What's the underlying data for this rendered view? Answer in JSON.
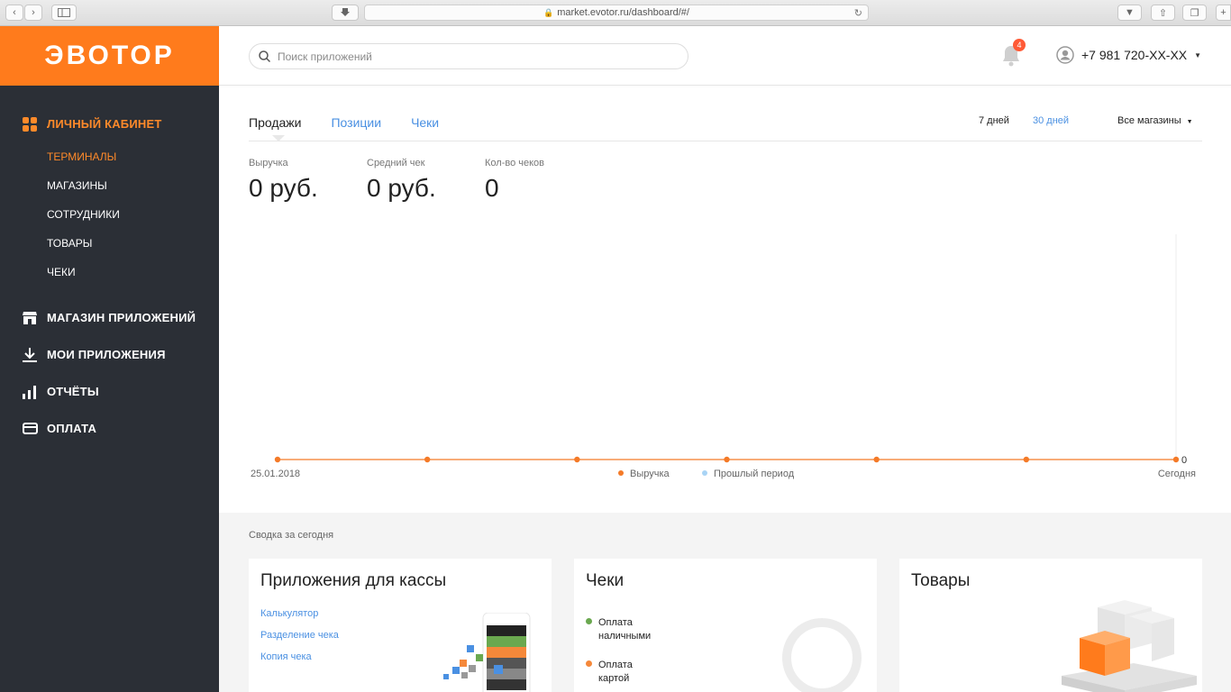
{
  "browser": {
    "url": "market.evotor.ru/dashboard/#/"
  },
  "brand": {
    "logo_text": "ЭВОТОР",
    "accent": "#ff7b1c"
  },
  "sidebar": {
    "personal": {
      "label": "ЛИЧНЫЙ КАБИНЕТ",
      "icon": "grid-icon"
    },
    "sub_items": [
      {
        "label": "ТЕРМИНАЛЫ",
        "active": true
      },
      {
        "label": "МАГАЗИНЫ"
      },
      {
        "label": "СОТРУДНИКИ"
      },
      {
        "label": "ТОВАРЫ"
      },
      {
        "label": "ЧЕКИ"
      }
    ],
    "sections": [
      {
        "label": "МАГАЗИН ПРИЛОЖЕНИЙ",
        "icon": "store-icon"
      },
      {
        "label": "МОИ ПРИЛОЖЕНИЯ",
        "icon": "download-icon"
      },
      {
        "label": "ОТЧЁТЫ",
        "icon": "bar-chart-icon"
      },
      {
        "label": "ОПЛАТА",
        "icon": "credit-card-icon"
      }
    ]
  },
  "topbar": {
    "search_placeholder": "Поиск приложений",
    "notifications_count": "4",
    "phone": "+7 981 720-XX-XX"
  },
  "main": {
    "tabs": [
      "Продажи",
      "Позиции",
      "Чеки"
    ],
    "active_tab": "Продажи",
    "periods": [
      "7 дней",
      "30 дней"
    ],
    "stores_filter": "Все магазины",
    "kpis": [
      {
        "label": "Выручка",
        "value": "0 руб."
      },
      {
        "label": "Средний чек",
        "value": "0 руб."
      },
      {
        "label": "Кол-во чеков",
        "value": "0"
      }
    ]
  },
  "chart_data": {
    "type": "line",
    "x_start_label": "25.01.2018",
    "x_end_label": "Сегодня",
    "y_label": "0",
    "series": [
      {
        "name": "Выручка",
        "color": "#f47a28",
        "values": [
          0,
          0,
          0,
          0,
          0,
          0,
          0
        ]
      },
      {
        "name": "Прошлый период",
        "color": "#a9d4f5",
        "values": []
      }
    ]
  },
  "summary": {
    "title": "Сводка за сегодня",
    "cards": {
      "apps": {
        "title": "Приложения для кассы",
        "links": [
          "Калькулятор",
          "Разделение чека",
          "Копия чека"
        ]
      },
      "receipts": {
        "title": "Чеки",
        "legend": [
          {
            "label_line1": "Оплата",
            "label_line2": "наличными",
            "color": "#6aa84f"
          },
          {
            "label_line1": "Оплата",
            "label_line2": "картой",
            "color": "#f5883a"
          }
        ]
      },
      "products": {
        "title": "Товары"
      }
    }
  }
}
